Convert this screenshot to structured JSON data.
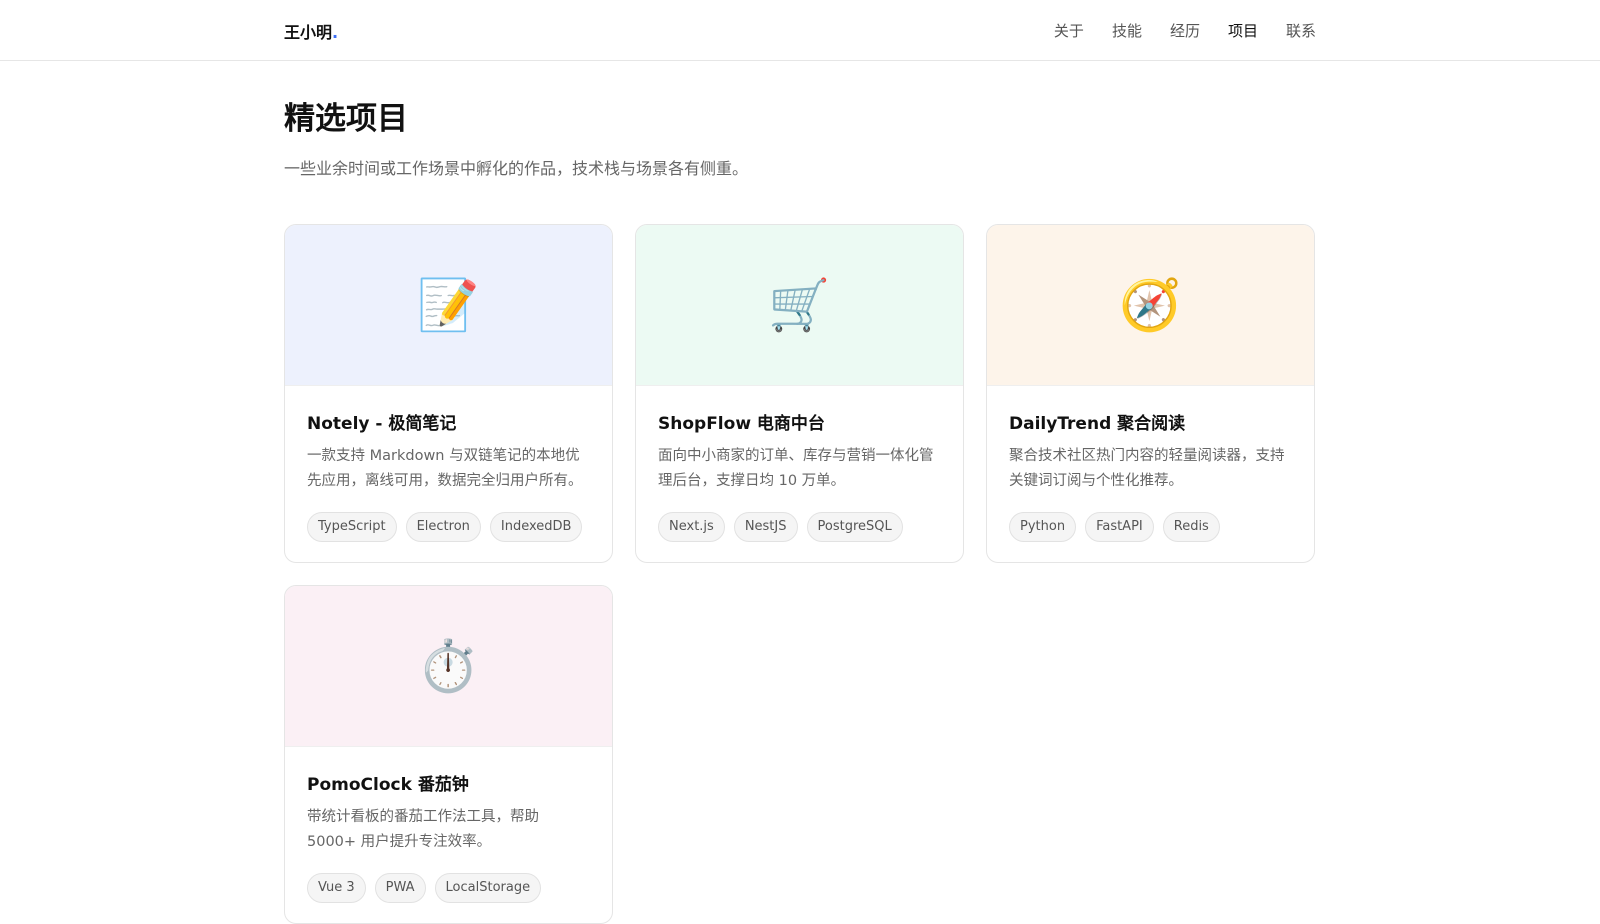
{
  "header": {
    "brand_name": "王小明",
    "brand_dot": ".",
    "nav": [
      {
        "label": "关于"
      },
      {
        "label": "技能"
      },
      {
        "label": "经历"
      },
      {
        "label": "项目"
      },
      {
        "label": "联系"
      }
    ],
    "active_nav": "项目"
  },
  "section": {
    "title": "精选项目",
    "subtitle": "一些业余时间或工作场景中孵化的作品，技术栈与场景各有侧重。"
  },
  "projects": [
    {
      "icon": "📝",
      "icon_name": "memo-icon",
      "hero_color": "#edf1fd",
      "title": "Notely - 极简笔记",
      "desc": "一款支持 Markdown 与双链笔记的本地优先应用，离线可用，数据完全归用户所有。",
      "tags": [
        "TypeScript",
        "Electron",
        "IndexedDB"
      ]
    },
    {
      "icon": "🛒",
      "icon_name": "shopping-cart-icon",
      "hero_color": "#ecfaf3",
      "title": "ShopFlow 电商中台",
      "desc": "面向中小商家的订单、库存与营销一体化管理后台，支撑日均 10 万单。",
      "tags": [
        "Next.js",
        "NestJS",
        "PostgreSQL"
      ]
    },
    {
      "icon": "🧭",
      "icon_name": "compass-icon",
      "hero_color": "#fdf4ea",
      "title": "DailyTrend 聚合阅读",
      "desc": "聚合技术社区热门内容的轻量阅读器，支持关键词订阅与个性化推荐。",
      "tags": [
        "Python",
        "FastAPI",
        "Redis"
      ]
    },
    {
      "icon": "⏱️",
      "icon_name": "stopwatch-icon",
      "hero_color": "#fbf0f5",
      "title": "PomoClock 番茄钟",
      "desc": "带统计看板的番茄工作法工具，帮助 5000+ 用户提升专注效率。",
      "tags": [
        "Vue 3",
        "PWA",
        "LocalStorage"
      ]
    }
  ]
}
